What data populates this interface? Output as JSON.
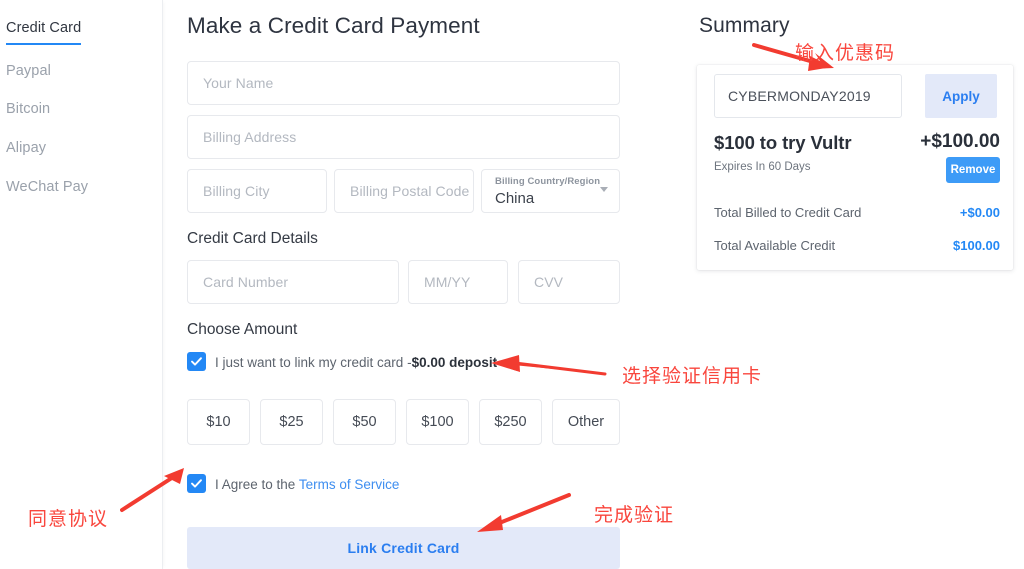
{
  "sidebar": {
    "items": [
      {
        "label": "Credit Card",
        "active": true
      },
      {
        "label": "Paypal",
        "active": false
      },
      {
        "label": "Bitcoin",
        "active": false
      },
      {
        "label": "Alipay",
        "active": false
      },
      {
        "label": "WeChat Pay",
        "active": false
      }
    ]
  },
  "main": {
    "title": "Make a Credit Card Payment",
    "fields": {
      "name_placeholder": "Your Name",
      "address_placeholder": "Billing Address",
      "city_placeholder": "Billing City",
      "postal_placeholder": "Billing Postal Code",
      "country_label": "Billing Country/Region",
      "country_value": "China"
    },
    "card_section_title": "Credit Card Details",
    "card_fields": {
      "number_placeholder": "Card Number",
      "expiry_placeholder": "MM/YY",
      "cvv_placeholder": "CVV"
    },
    "amount_section_title": "Choose Amount",
    "link_checkbox": {
      "checked": true,
      "text": "I just want to link my credit card -",
      "bold_text": "$0.00 deposit"
    },
    "amount_options": [
      "$10",
      "$25",
      "$50",
      "$100",
      "$250",
      "Other"
    ],
    "terms_checkbox": {
      "checked": true,
      "text": "I Agree to the ",
      "link_text": "Terms of Service"
    },
    "submit_label": "Link Credit Card"
  },
  "summary": {
    "title": "Summary",
    "promo_code_value": "CYBERMONDAY2019",
    "apply_label": "Apply",
    "promo_title": "$100 to try Vultr",
    "promo_amount": "+$100.00",
    "promo_expiry": "Expires In 60 Days",
    "remove_label": "Remove",
    "totals": [
      {
        "label": "Total Billed to Credit Card",
        "value": "+$0.00"
      },
      {
        "label": "Total Available Credit",
        "value": "$100.00"
      }
    ]
  },
  "annotations": [
    {
      "text": "输入优惠码",
      "id": "enter-promo-code"
    },
    {
      "text": "选择验证信用卡",
      "id": "select-verify-card"
    },
    {
      "text": "同意协议",
      "id": "agree-terms"
    },
    {
      "text": "完成验证",
      "id": "complete-verification"
    }
  ],
  "colors": {
    "accent_blue": "#2388f5",
    "annotation_red": "#f9463d",
    "button_light_blue": "#e3e9f9"
  }
}
